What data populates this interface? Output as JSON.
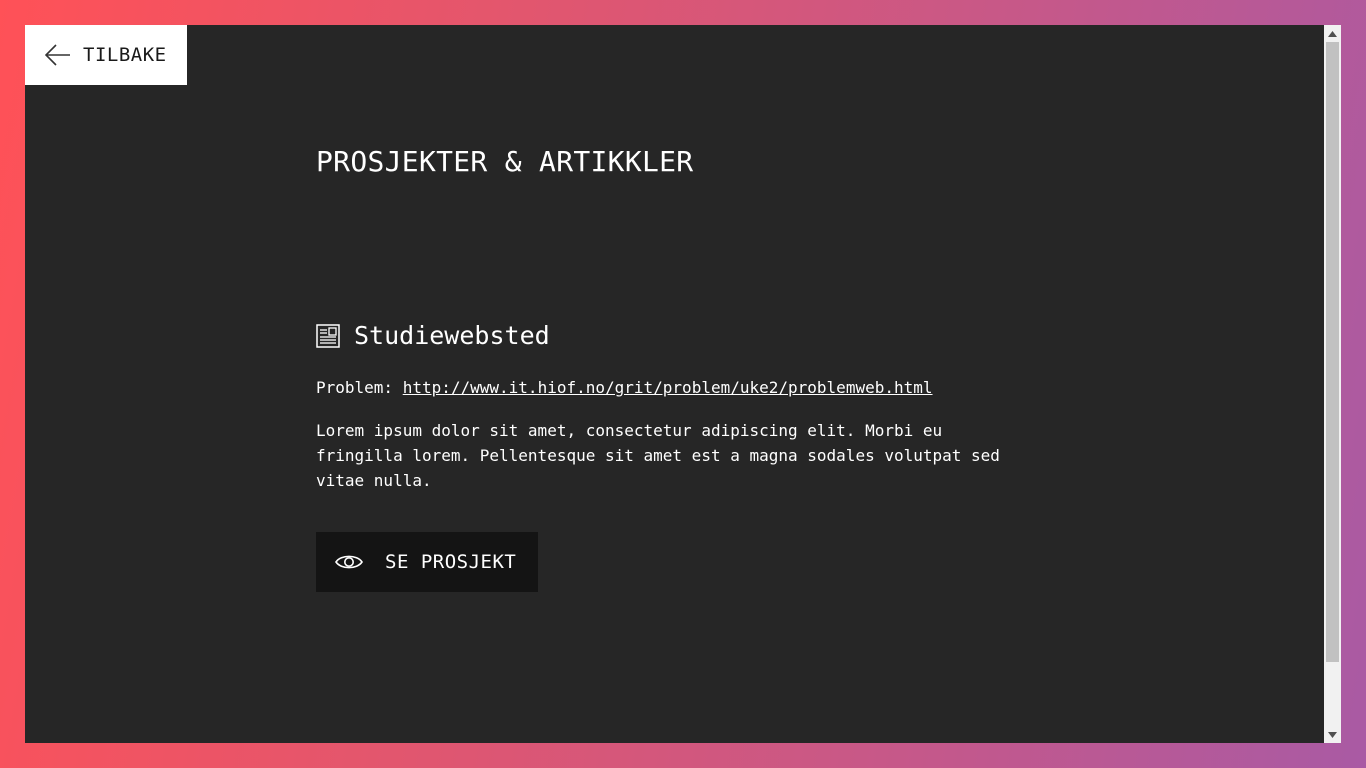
{
  "nav": {
    "back_label": "TILBAKE",
    "back_icon": "arrow-left-icon"
  },
  "page": {
    "title": "PROSJEKTER & ARTIKKLER"
  },
  "project": {
    "icon": "document-icon",
    "name": "Studiewebsted",
    "problem_label": "Problem:",
    "problem_url": "http://www.it.hiof.no/grit/problem/uke2/problemweb.html",
    "description": "Lorem ipsum dolor sit amet, consectetur adipiscing elit. Morbi eu fringilla lorem. Pellentesque sit amet est a magna sodales volutpat sed vitae nulla.",
    "view_label": "SE PROSJEKT",
    "view_icon": "eye-icon"
  },
  "colors": {
    "background_gradient_start": "#ff5157",
    "background_gradient_end": "#a95aa4",
    "panel": "#262626",
    "button_dark": "#141414",
    "text": "#ffffff"
  }
}
